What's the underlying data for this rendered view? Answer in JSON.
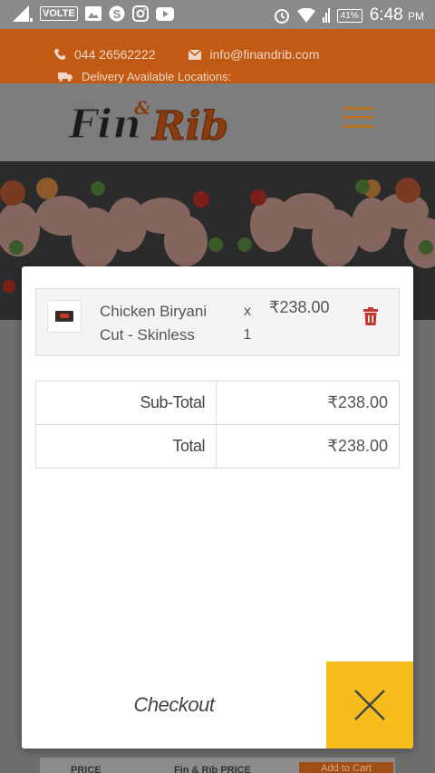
{
  "status_bar": {
    "volte_label": "VOLTE",
    "battery": "41%",
    "time": "6:48",
    "ampm": "PM"
  },
  "contact": {
    "phone": "044 26562222",
    "email": "info@finandrib.com",
    "delivery": "Delivery Available Locations:"
  },
  "cart": {
    "items": [
      {
        "name": "Chicken Biryani Cut - Skinless",
        "qty_sign": "x",
        "qty": "1",
        "price": "₹238.00"
      }
    ],
    "subtotal_label": "Sub-Total",
    "subtotal_value": "₹238.00",
    "total_label": "Total",
    "total_value": "₹238.00",
    "checkout_label": "Checkout"
  },
  "bottom": {
    "price_label": "PRICE",
    "finrib_price_label": "Fin & Rib PRICE",
    "add_to_cart": "Add to Cart"
  },
  "colors": {
    "accent_orange": "#c05a14",
    "close_yellow": "#f7bd1c",
    "trash_red": "#c0392b"
  }
}
